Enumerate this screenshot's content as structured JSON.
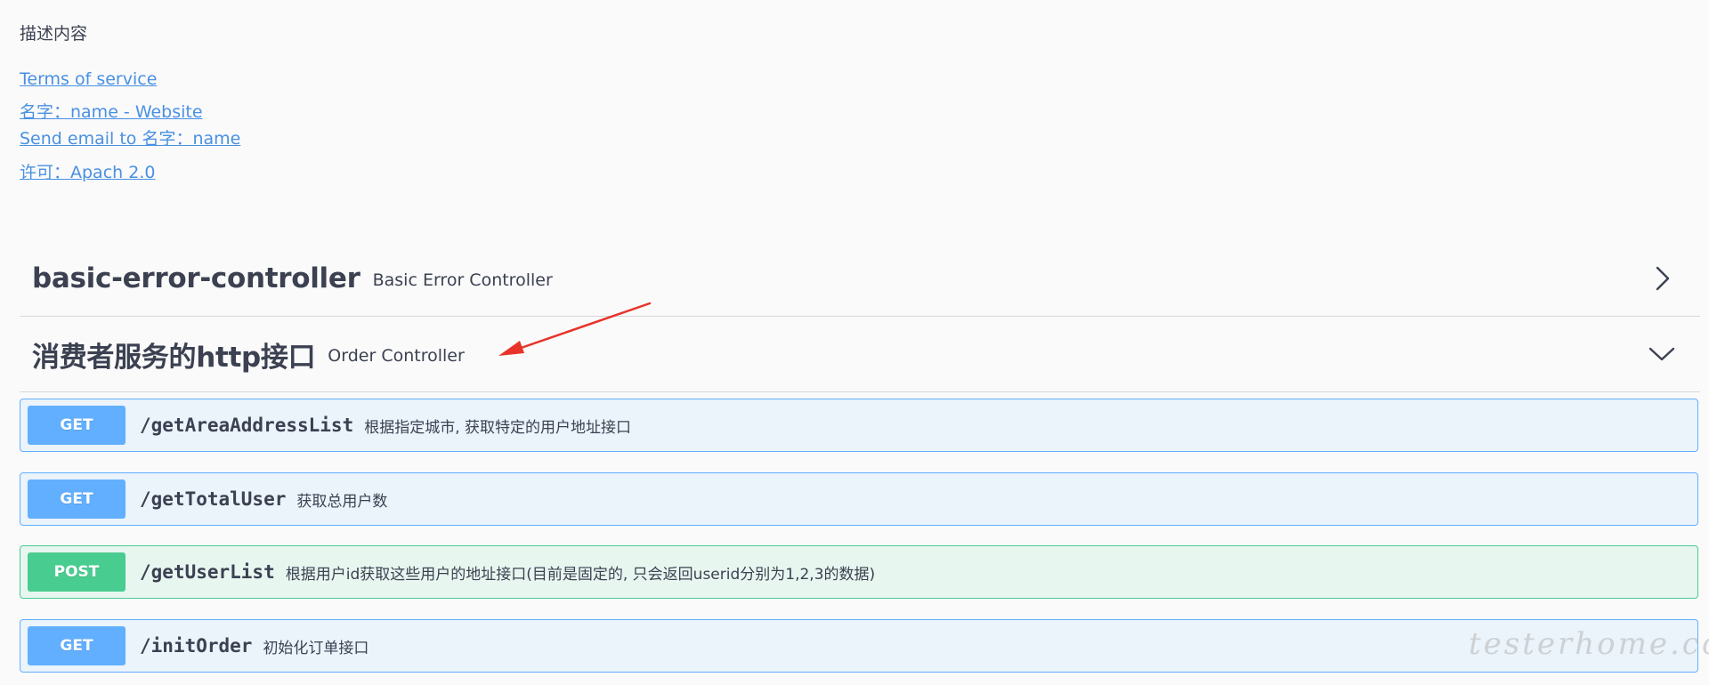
{
  "info": {
    "description": "描述内容",
    "terms_of_service": "Terms of service",
    "contact_website": "名字：name - Website",
    "contact_email": "Send email to 名字：name",
    "license": "许可：Apach 2.0"
  },
  "tags": [
    {
      "name": "basic-error-controller",
      "description": "Basic Error Controller",
      "icon": "chevron-right-icon",
      "expanded": false
    },
    {
      "name": "消费者服务的http接口",
      "description": "Order Controller",
      "icon": "chevron-down-icon",
      "expanded": true
    }
  ],
  "operations": [
    {
      "method": "GET",
      "path": "/getAreaAddressList",
      "summary": "根据指定城市, 获取特定的用户地址接口"
    },
    {
      "method": "GET",
      "path": "/getTotalUser",
      "summary": "获取总用户数"
    },
    {
      "method": "POST",
      "path": "/getUserList",
      "summary": "根据用户id获取这些用户的地址接口(目前是固定的, 只会返回userid分别为1,2,3的数据)"
    },
    {
      "method": "GET",
      "path": "/initOrder",
      "summary": "初始化订单接口"
    }
  ],
  "colors": {
    "link": "#4990e2",
    "get": "#61affe",
    "get_bg": "#ebf3fb",
    "post": "#49cc90",
    "post_bg": "#e8f6f0",
    "annotation_arrow": "#e8332a"
  },
  "watermark": "testerhome.com"
}
